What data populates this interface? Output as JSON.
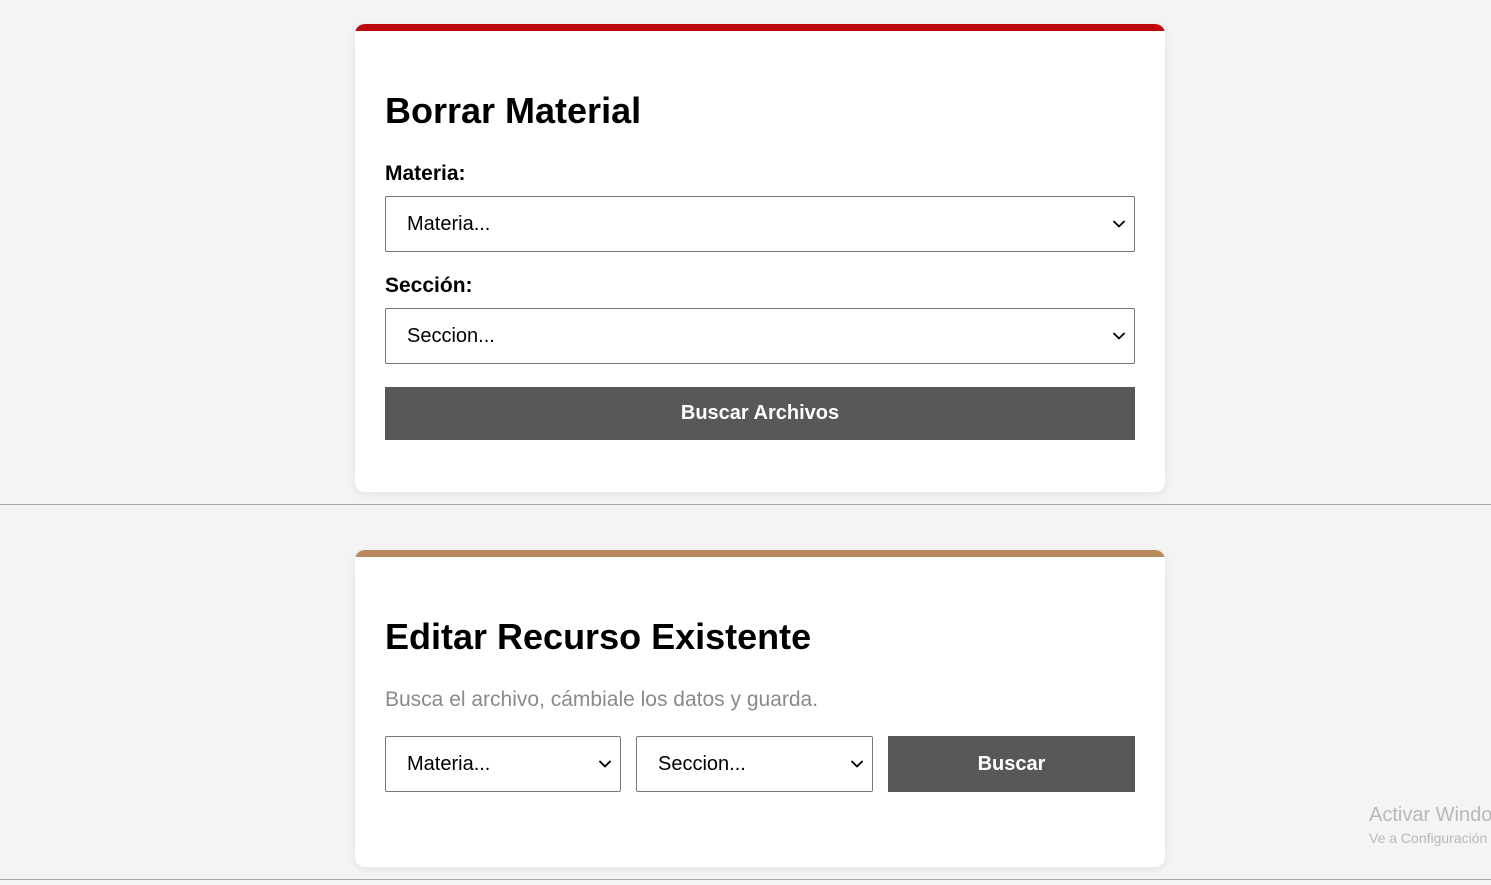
{
  "borrar": {
    "title": "Borrar Material",
    "materia_label": "Materia:",
    "materia_value": "Materia...",
    "seccion_label": "Sección:",
    "seccion_value": "Seccion...",
    "button_label": "Buscar Archivos",
    "accent_color": "#c0060d"
  },
  "editar": {
    "title": "Editar Recurso Existente",
    "subtitle": "Busca el archivo, cámbiale los datos y guarda.",
    "materia_value": "Materia...",
    "seccion_value": "Seccion...",
    "button_label": "Buscar",
    "accent_color": "#b98a5c"
  },
  "watermark": {
    "line1": "Activar Windo",
    "line2": "Ve a Configuración"
  },
  "icons": {
    "select_arrow": "chevron-down-icon"
  }
}
